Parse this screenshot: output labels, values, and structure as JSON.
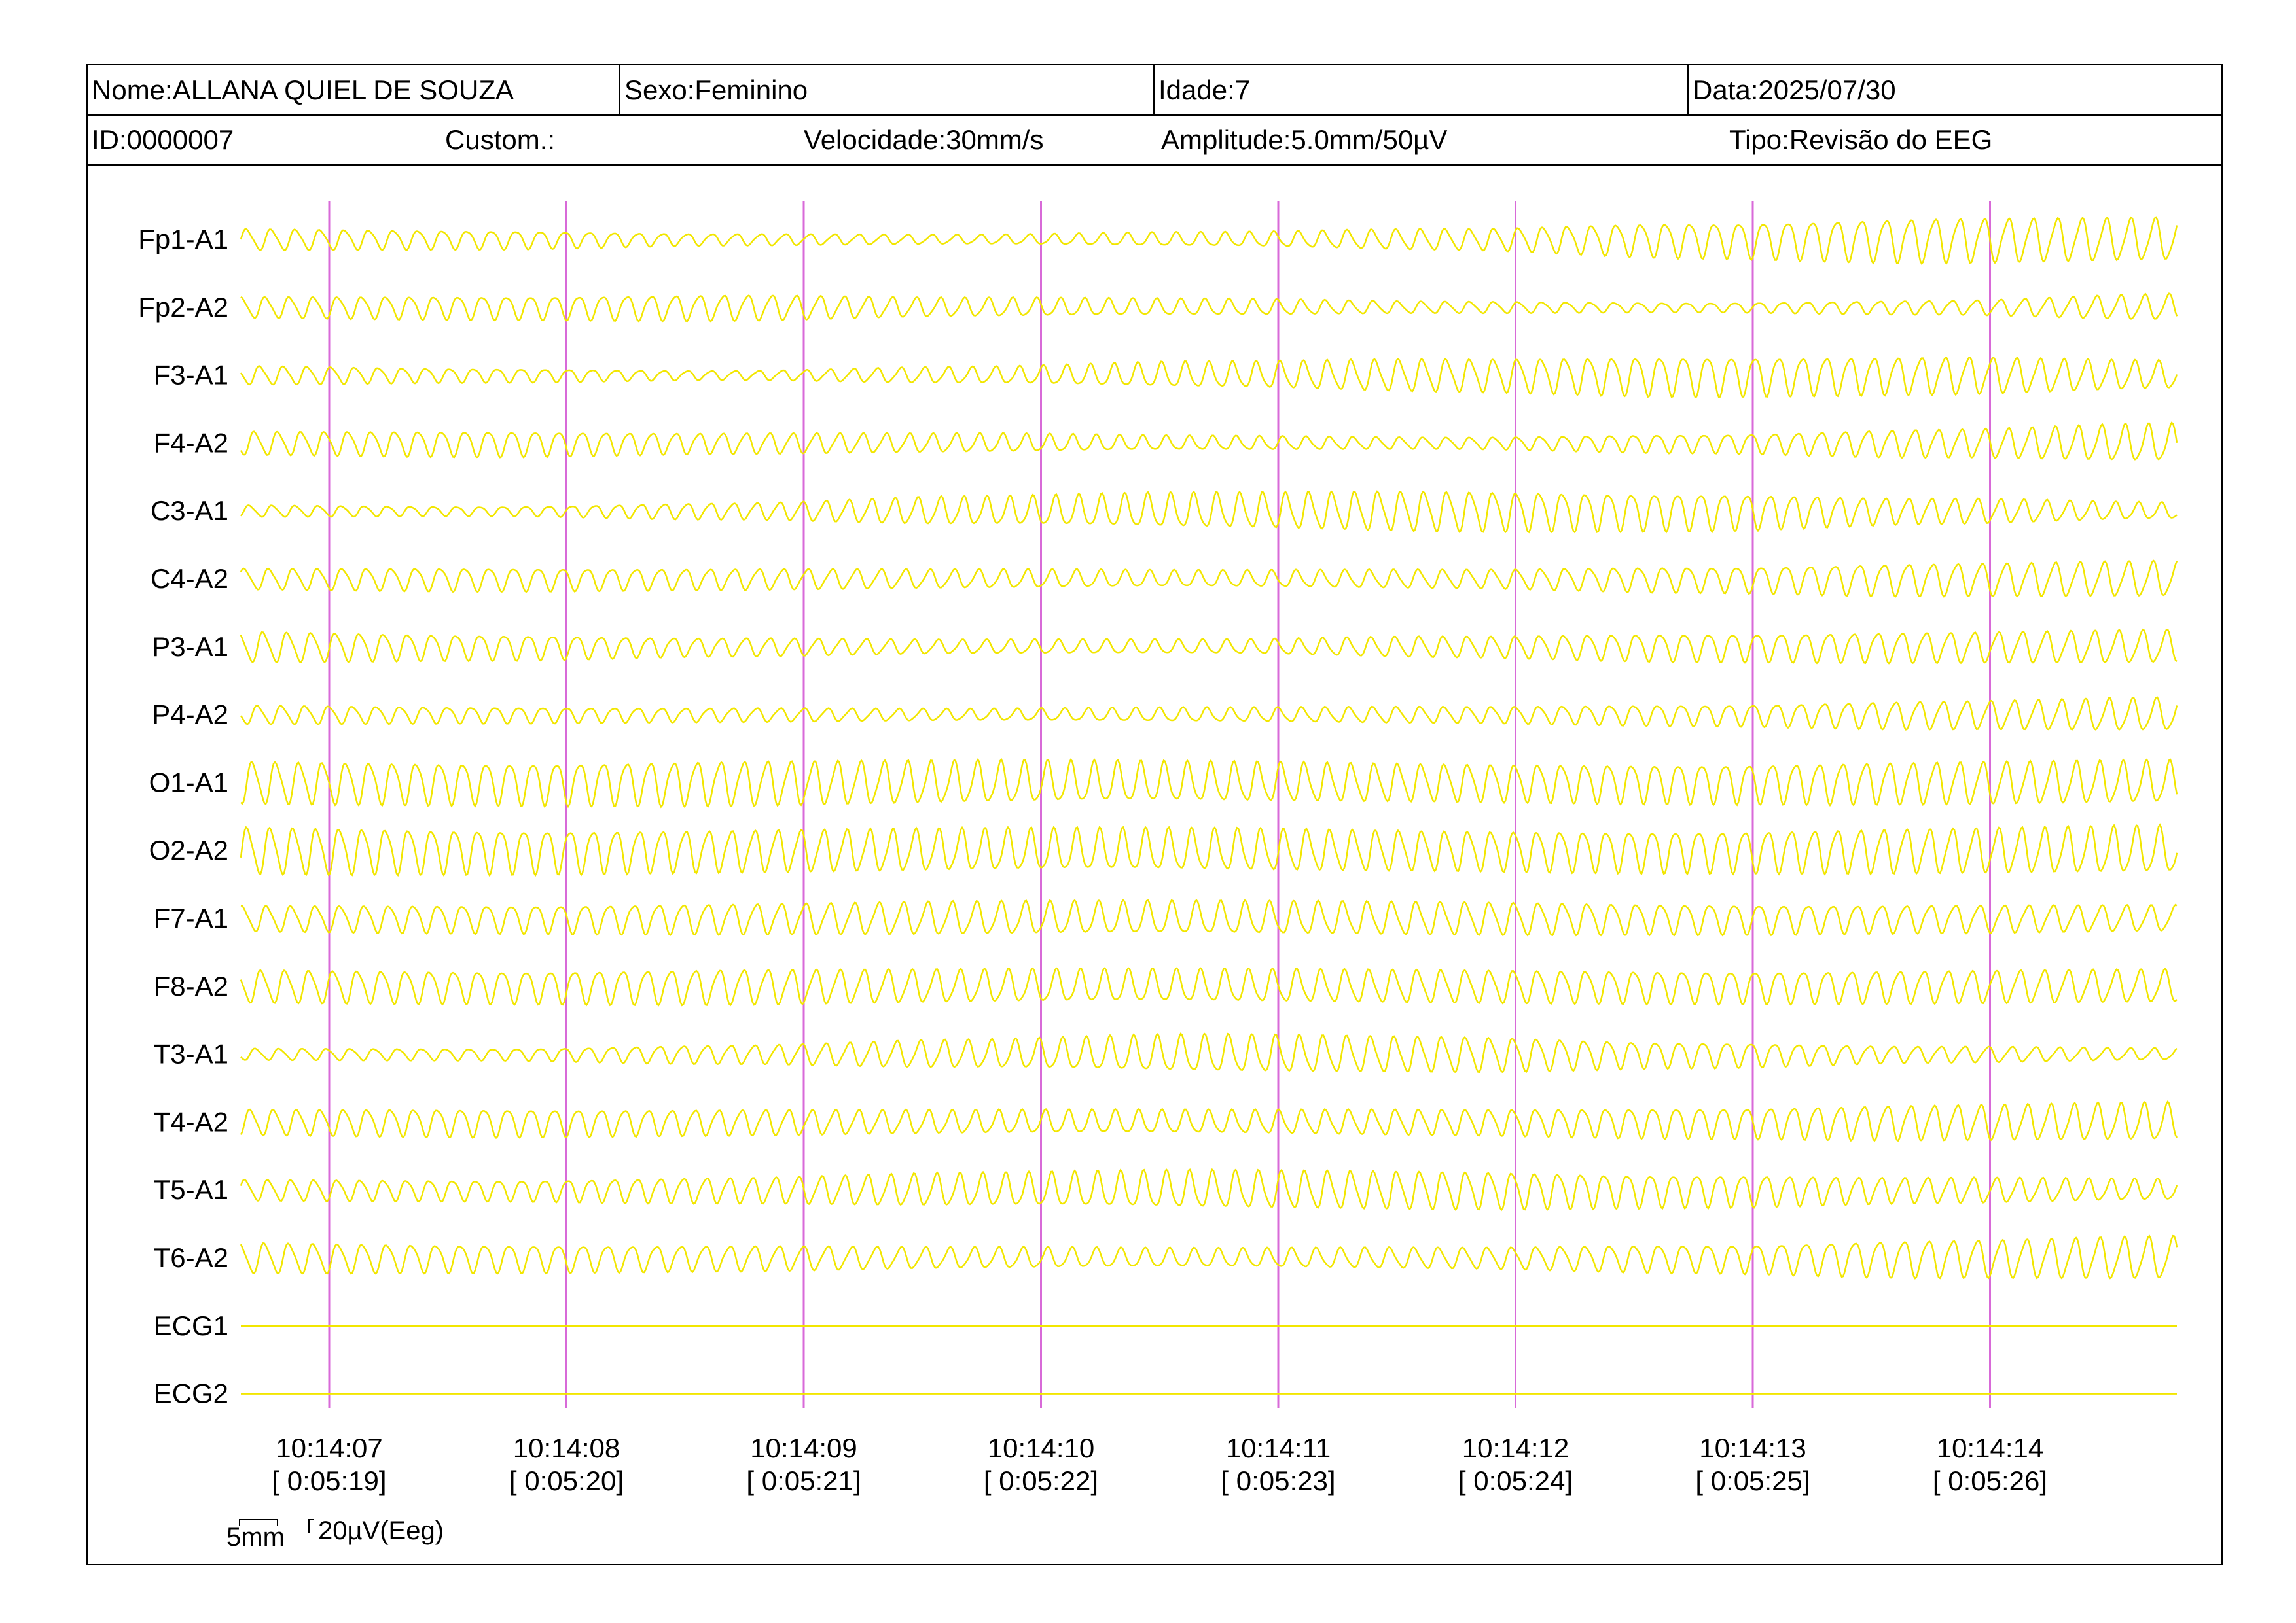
{
  "header": {
    "name": "Nome:ALLANA QUIEL DE SOUZA",
    "sex": "Sexo:Feminino",
    "age": "Idade:7",
    "date": "Data:2025/07/30",
    "id": "ID:0000007",
    "custom": "Custom.:",
    "speed": "Velocidade:30mm/s",
    "amplitude": "Amplitude:5.0mm/50µV",
    "type": "Tipo:Revisão do EEG"
  },
  "scale": {
    "time_label": "5mm",
    "amp_label": "20µV(Eeg)"
  },
  "colors": {
    "trace": "#f2e600",
    "marker": "#d86ad8",
    "text": "#000000"
  },
  "chart_data": {
    "type": "line",
    "title": "",
    "channels": [
      {
        "name": "Fp1-A1",
        "amplitude": [
          0.45,
          0.4,
          0.25,
          0.2,
          0.3,
          0.45,
          0.75,
          0.95,
          0.9
        ]
      },
      {
        "name": "Fp2-A2",
        "amplitude": [
          0.45,
          0.5,
          0.55,
          0.4,
          0.35,
          0.25,
          0.2,
          0.3,
          0.55
        ]
      },
      {
        "name": "F3-A1",
        "amplitude": [
          0.4,
          0.3,
          0.2,
          0.35,
          0.55,
          0.7,
          0.85,
          0.8,
          0.6
        ]
      },
      {
        "name": "F4-A2",
        "amplitude": [
          0.5,
          0.55,
          0.45,
          0.4,
          0.3,
          0.25,
          0.4,
          0.6,
          0.8
        ]
      },
      {
        "name": "C3-A1",
        "amplitude": [
          0.25,
          0.2,
          0.35,
          0.6,
          0.75,
          0.85,
          0.8,
          0.55,
          0.35
        ]
      },
      {
        "name": "C4-A2",
        "amplitude": [
          0.45,
          0.5,
          0.45,
          0.4,
          0.35,
          0.4,
          0.55,
          0.7,
          0.75
        ]
      },
      {
        "name": "P3-A1",
        "amplitude": [
          0.65,
          0.55,
          0.4,
          0.3,
          0.3,
          0.45,
          0.6,
          0.65,
          0.7
        ]
      },
      {
        "name": "P4-A2",
        "amplitude": [
          0.4,
          0.35,
          0.3,
          0.25,
          0.3,
          0.35,
          0.45,
          0.6,
          0.7
        ]
      },
      {
        "name": "O1-A1",
        "amplitude": [
          0.9,
          0.9,
          0.95,
          0.9,
          0.85,
          0.8,
          0.85,
          0.9,
          0.9
        ]
      },
      {
        "name": "O2-A2",
        "amplitude": [
          1.0,
          0.95,
          0.9,
          0.9,
          0.9,
          0.85,
          0.9,
          0.95,
          1.0
        ]
      },
      {
        "name": "F7-A1",
        "amplitude": [
          0.55,
          0.6,
          0.65,
          0.7,
          0.7,
          0.7,
          0.65,
          0.6,
          0.55
        ]
      },
      {
        "name": "F8-A2",
        "amplitude": [
          0.7,
          0.7,
          0.75,
          0.7,
          0.7,
          0.7,
          0.7,
          0.7,
          0.7
        ]
      },
      {
        "name": "T3-A1",
        "amplitude": [
          0.25,
          0.25,
          0.4,
          0.6,
          0.8,
          0.75,
          0.55,
          0.35,
          0.25
        ]
      },
      {
        "name": "T4-A2",
        "amplitude": [
          0.55,
          0.6,
          0.55,
          0.5,
          0.5,
          0.55,
          0.65,
          0.75,
          0.8
        ]
      },
      {
        "name": "T5-A1",
        "amplitude": [
          0.45,
          0.45,
          0.55,
          0.7,
          0.8,
          0.8,
          0.7,
          0.55,
          0.45
        ]
      },
      {
        "name": "T6-A2",
        "amplitude": [
          0.65,
          0.6,
          0.55,
          0.45,
          0.4,
          0.45,
          0.6,
          0.8,
          0.9
        ]
      },
      {
        "name": "ECG1",
        "amplitude": [
          0,
          0,
          0,
          0,
          0,
          0,
          0,
          0,
          0
        ]
      },
      {
        "name": "ECG2",
        "amplitude": [
          0,
          0,
          0,
          0,
          0,
          0,
          0,
          0,
          0
        ]
      }
    ],
    "time_markers": [
      {
        "time": "10:14:07",
        "elapsed": "[ 0:05:19]"
      },
      {
        "time": "10:14:08",
        "elapsed": "[ 0:05:20]"
      },
      {
        "time": "10:14:09",
        "elapsed": "[ 0:05:21]"
      },
      {
        "time": "10:14:10",
        "elapsed": "[ 0:05:22]"
      },
      {
        "time": "10:14:11",
        "elapsed": "[ 0:05:23]"
      },
      {
        "time": "10:14:12",
        "elapsed": "[ 0:05:24]"
      },
      {
        "time": "10:14:13",
        "elapsed": "[ 0:05:25]"
      },
      {
        "time": "10:14:14",
        "elapsed": "[ 0:05:26]"
      }
    ],
    "dominant_frequency_hz": 10,
    "grid": false
  }
}
